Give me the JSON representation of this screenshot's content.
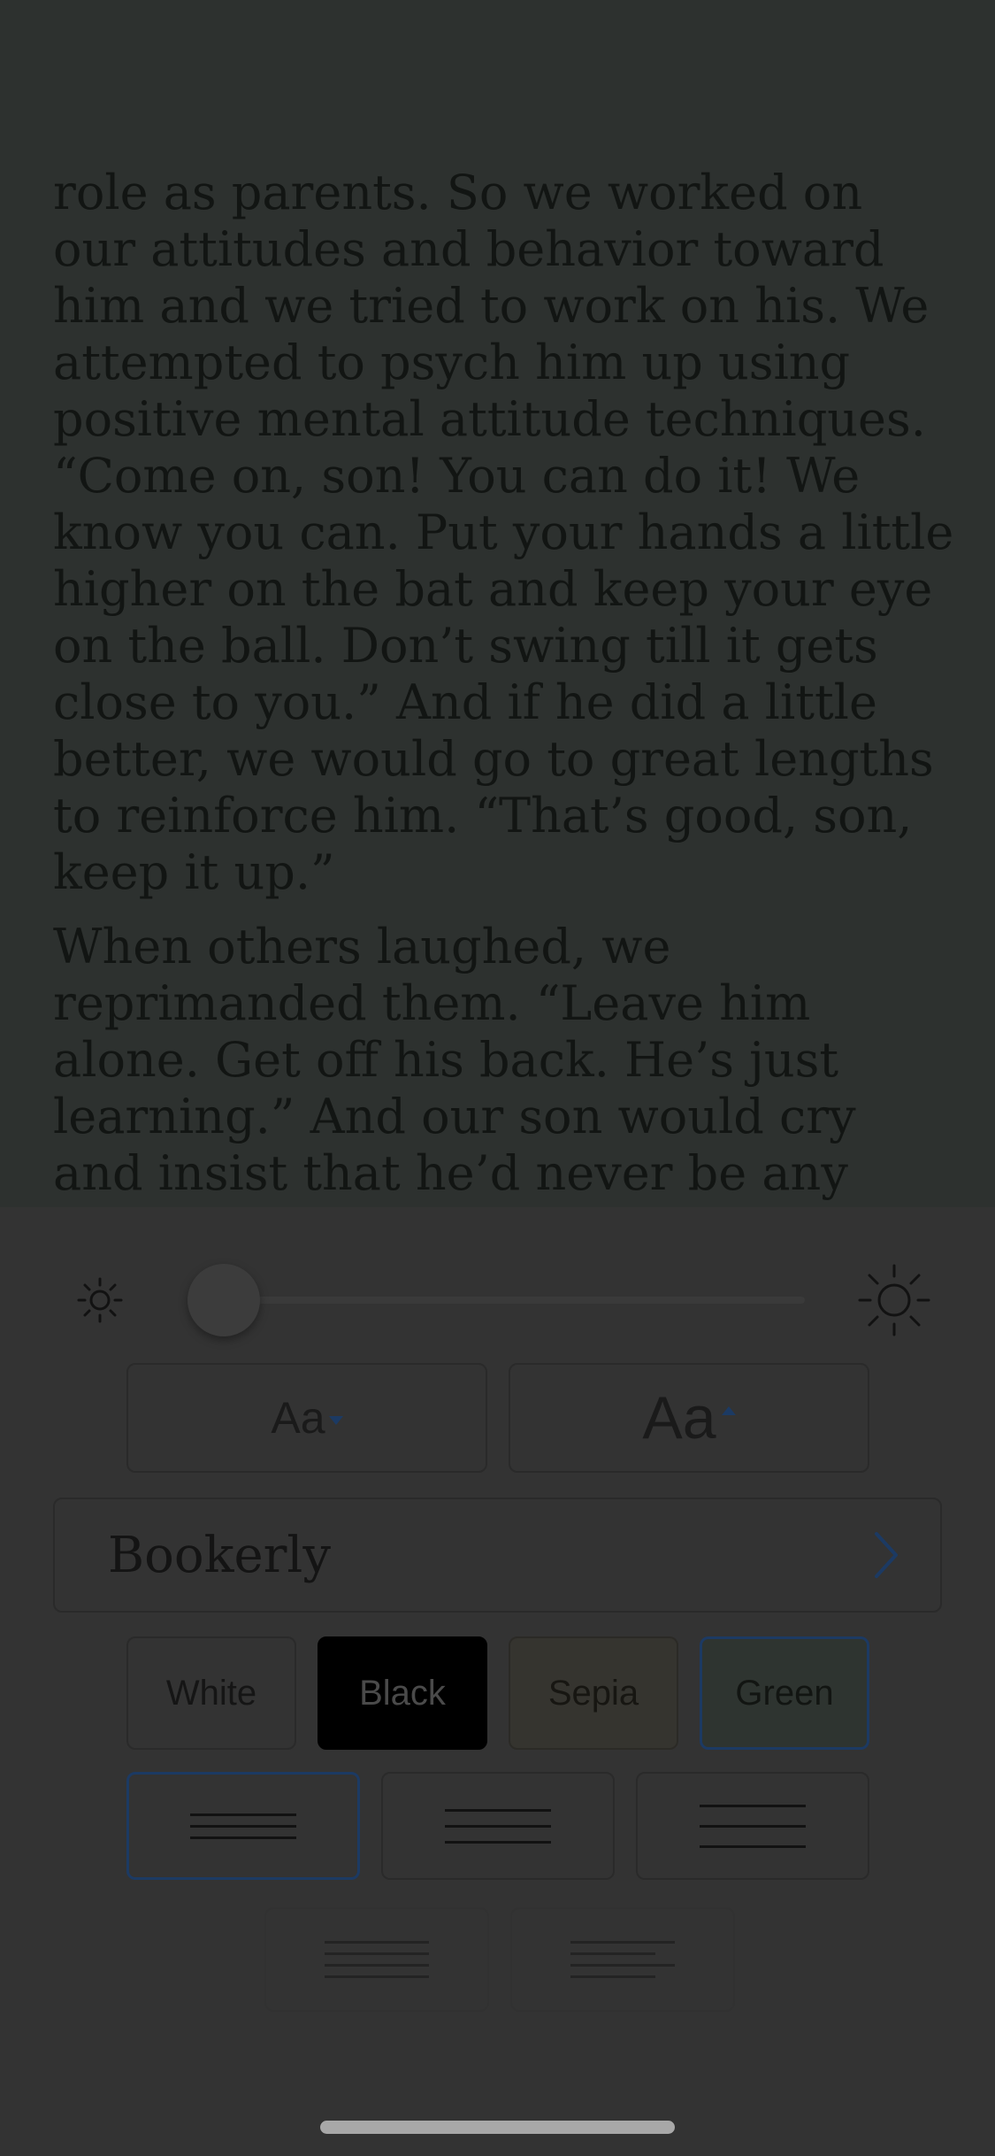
{
  "reader": {
    "paragraphs": [
      "role as parents. So we worked on our attitudes and behavior toward him and we tried to work on his. We attempted to psych him up using positive mental attitude techniques. “Come on, son! You can do it! We know you can. Put your hands a little higher on the bat and keep your eye on the ball. Don’t swing till it gets close to you.” And if he did a little better, we would go to great lengths to reinforce him. “That’s good, son, keep it up.”",
      "When others laughed, we reprimanded them. “Leave him alone. Get off his back. He’s just learning.” And our son would cry and insist that he’d never be any good and that he didn’t like baseball anyway."
    ]
  },
  "settings": {
    "brightness": {
      "value": 0.05,
      "min_icon": "sun-small-icon",
      "max_icon": "sun-large-icon"
    },
    "font_size": {
      "decrease_label": "Aa",
      "increase_label": "Aa"
    },
    "font": {
      "name": "Bookerly",
      "icon": "chevron-right-icon"
    },
    "themes": [
      {
        "label": "White",
        "bg": "#333333",
        "fg": "#151515",
        "border": "#2a2a2a"
      },
      {
        "label": "Black",
        "bg": "#000000",
        "fg": "#4a4a4a",
        "border": "#000000"
      },
      {
        "label": "Sepia",
        "bg": "#35342f",
        "fg": "#171612",
        "border": "#2b2a26"
      },
      {
        "label": "Green",
        "bg": "#2e3430",
        "fg": "#121512",
        "border": "#1c3a63",
        "selected": true
      }
    ],
    "line_spacing_selected": 0,
    "accent_color": "#1c3a63"
  }
}
